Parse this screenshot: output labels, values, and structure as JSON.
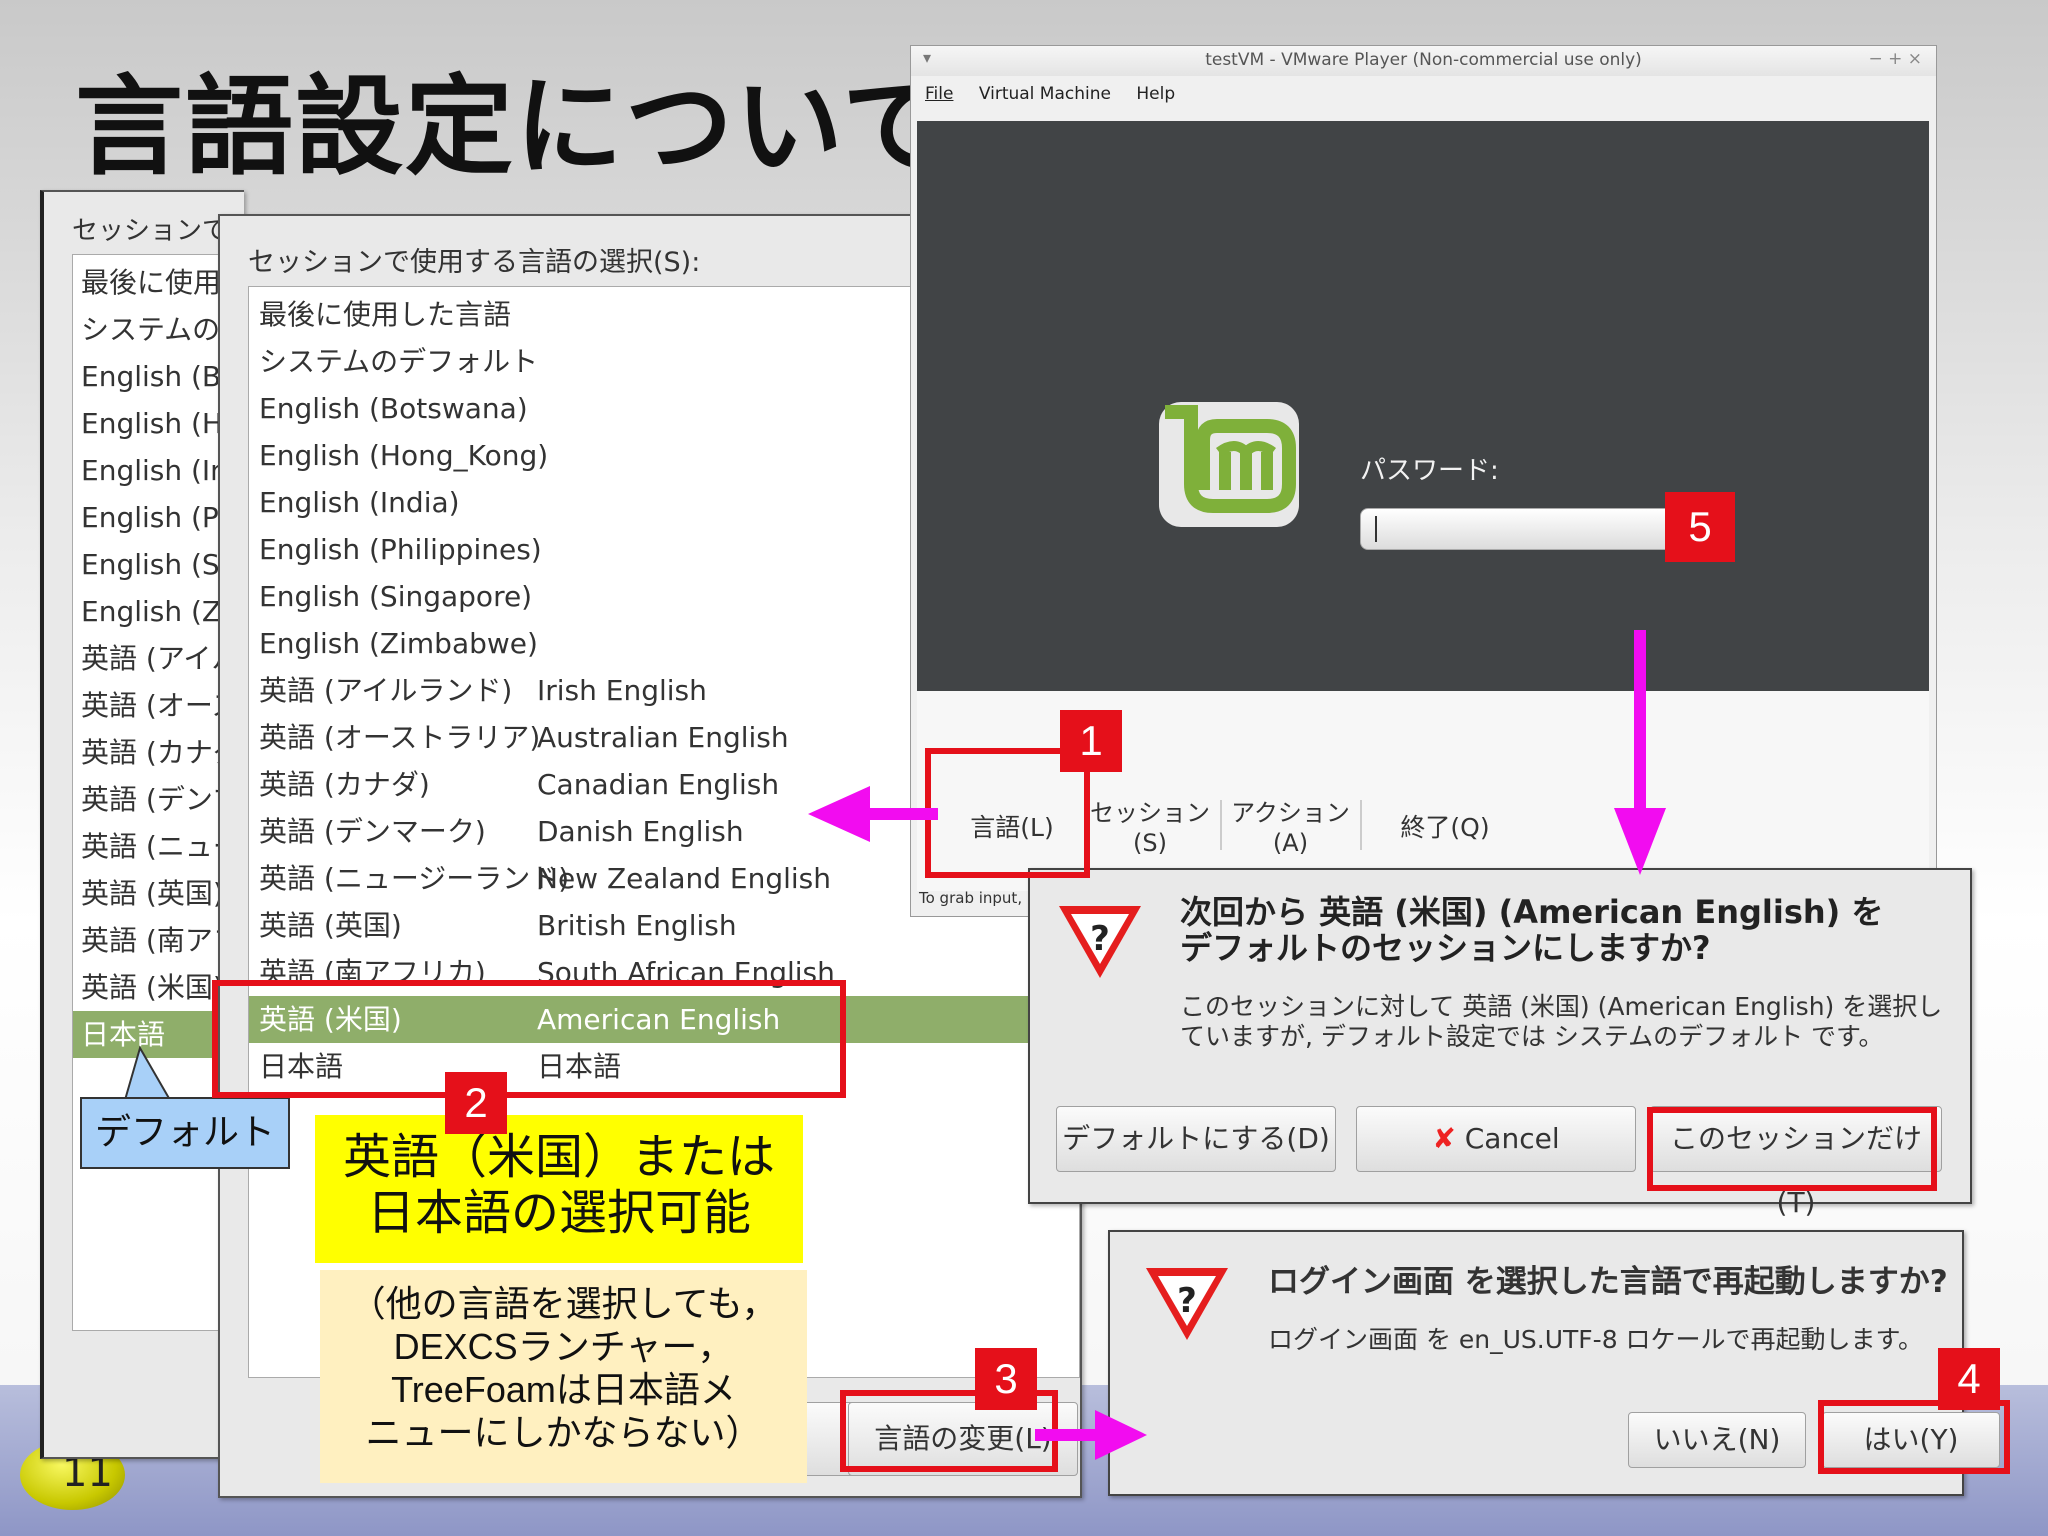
{
  "slide": {
    "title": "言語設定について",
    "page_number": "11"
  },
  "back_dialog": {
    "heading": "セッションで使用する言語の選択(S):",
    "visible_heading": "セッションで使",
    "items": [
      "最後に使用",
      "システムの",
      "English (B",
      "English (H",
      "English (In",
      "English (P",
      "English (Si",
      "English (Zi",
      "英語 (アイル",
      "英語 (オース",
      "英語 (カナダ",
      "英語 (デンマ",
      "英語 (ニュー",
      "英語 (英国)",
      "英語 (南アフ",
      "英語 (米国)",
      "日本語"
    ],
    "selected_index": 16
  },
  "lang_dialog": {
    "heading": "セッションで使用する言語の選択(S):",
    "items": [
      {
        "name": "最後に使用した言語",
        "native": ""
      },
      {
        "name": "システムのデフォルト",
        "native": ""
      },
      {
        "name": "English (Botswana)",
        "native": ""
      },
      {
        "name": "English (Hong_Kong)",
        "native": ""
      },
      {
        "name": "English (India)",
        "native": ""
      },
      {
        "name": "English (Philippines)",
        "native": ""
      },
      {
        "name": "English (Singapore)",
        "native": ""
      },
      {
        "name": "English (Zimbabwe)",
        "native": ""
      },
      {
        "name": "英語 (アイルランド)",
        "native": "Irish English"
      },
      {
        "name": "英語 (オーストラリア)",
        "native": "Australian English"
      },
      {
        "name": "英語 (カナダ)",
        "native": "Canadian English"
      },
      {
        "name": "英語 (デンマーク)",
        "native": "Danish English"
      },
      {
        "name": "英語 (ニュージーランド)",
        "native": "New Zealand English"
      },
      {
        "name": "英語 (英国)",
        "native": "British English"
      },
      {
        "name": "英語 (南アフリカ)",
        "native": "South African English"
      },
      {
        "name": "英語 (米国)",
        "native": "American English"
      },
      {
        "name": "日本語",
        "native": "日本語"
      }
    ],
    "selected_index": 15,
    "change_button": "言語の変更(L)"
  },
  "callouts": {
    "default_label": "デフォルト",
    "yellow_line1": "英語（米国）または",
    "yellow_line2": "日本語の選択可能",
    "note_line1": "（他の言語を選択しても，",
    "note_line2": "DEXCSランチャー，",
    "note_line3": "TreeFoamは日本語メ",
    "note_line4": "ニューにしかならない）"
  },
  "vm_window": {
    "title": "testVM - VMware Player (Non-commercial use only)",
    "win_controls": "− + ×",
    "menu": [
      "File",
      "Virtual Machine",
      "Help"
    ],
    "password_label": "パスワード:",
    "bottom_buttons": {
      "language": "言語(L)",
      "session_l1": "セッション",
      "session_l2": "(S)",
      "action_l1": "アクション",
      "action_l2": "(A)",
      "quit": "終了(Q)"
    },
    "status": "To grab input, p"
  },
  "default_session_dialog": {
    "title_l1": "次回から 英語 (米国) (American English) を",
    "title_l2": "デフォルトのセッションにしますか?",
    "body_l1": "このセッションに対して 英語 (米国) (American English) を選択し",
    "body_l2": "ていますが, デフォルト設定では システムのデフォルト です。",
    "btn_default": "デフォルトにする(D)",
    "btn_cancel": "Cancel",
    "btn_session": "このセッションだけ(T)"
  },
  "restart_dialog": {
    "title": "ログイン画面 を選択した言語で再起動しますか?",
    "body": "ログイン画面 を en_US.UTF-8 ロケールで再起動します。",
    "btn_no": "いいえ(N)",
    "btn_yes": "はい(Y)"
  },
  "step_numbers": [
    "1",
    "2",
    "3",
    "4",
    "5"
  ],
  "colors": {
    "highlight_red": "#e5101a",
    "arrow_magenta": "#f20cf0",
    "selected_green": "#8fae6a",
    "callout_yellow": "#ffff00",
    "note_cream": "#fff0c0",
    "default_blue": "#a8d0f8"
  }
}
